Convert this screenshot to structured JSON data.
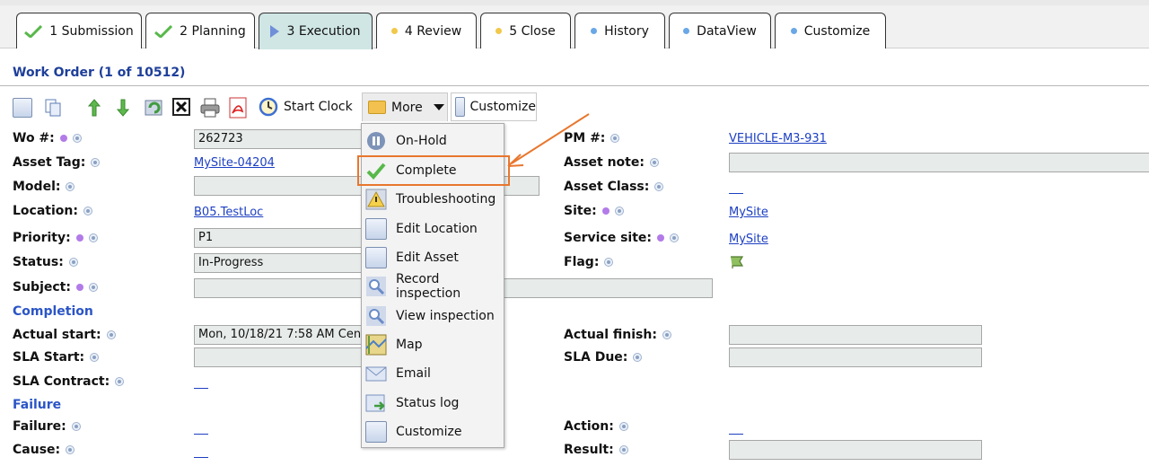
{
  "tabs": [
    {
      "label": "1 Submission",
      "marker": "check-icon"
    },
    {
      "label": "2 Planning",
      "marker": "check-icon"
    },
    {
      "label": "3 Execution",
      "marker": "play-icon",
      "active": true
    },
    {
      "label": "4 Review",
      "marker": "yellow-dot-icon"
    },
    {
      "label": "5 Close",
      "marker": "yellow-dot-icon"
    },
    {
      "label": "History",
      "marker": "blue-dot-icon"
    },
    {
      "label": "DataView",
      "marker": "blue-dot-icon"
    },
    {
      "label": "Customize",
      "marker": "blue-dot-icon"
    }
  ],
  "header": {
    "title": "Work Order (1 of 10512)"
  },
  "toolbar": {
    "start_clock": "Start Clock",
    "more": "More",
    "customize": "Customize"
  },
  "menu": {
    "items": [
      {
        "label": "On-Hold",
        "icon": "pause-icon"
      },
      {
        "label": "Complete",
        "icon": "check-icon"
      },
      {
        "label": "Troubleshooting",
        "icon": "warning-icon"
      },
      {
        "label": "Edit Location",
        "icon": "edit-icon"
      },
      {
        "label": "Edit Asset",
        "icon": "edit-icon"
      },
      {
        "label": "Record inspection",
        "icon": "magnifier-icon"
      },
      {
        "label": "View inspection",
        "icon": "magnifier-icon"
      },
      {
        "label": "Map",
        "icon": "map-icon"
      },
      {
        "label": "Email",
        "icon": "email-icon"
      },
      {
        "label": "Status log",
        "icon": "status-log-icon"
      },
      {
        "label": "Customize",
        "icon": "edit-icon"
      }
    ]
  },
  "form": {
    "wo_label": "Wo #:",
    "wo_value": "262723",
    "asset_tag_label": "Asset Tag:",
    "asset_tag_value": "MySite-04204",
    "model_label": "Model:",
    "location_label": "Location:",
    "location_value": "B05.TestLoc",
    "priority_label": "Priority:",
    "priority_value": "P1",
    "status_label": "Status:",
    "status_value": "In-Progress",
    "subject_label": "Subject:",
    "completion_section": "Completion",
    "actual_start_label": "Actual start:",
    "actual_start_value": "Mon, 10/18/21 7:58 AM Cen",
    "sla_start_label": "SLA Start:",
    "sla_contract_label": "SLA Contract:",
    "failure_section": "Failure",
    "failure_label": "Failure:",
    "cause_label": "Cause:",
    "pm_label": "PM #:",
    "pm_value": "VEHICLE-M3-931",
    "asset_note_label": "Asset note:",
    "asset_class_label": "Asset Class:",
    "site_label": "Site:",
    "site_value": "MySite",
    "service_site_label": "Service site:",
    "service_site_value": "MySite",
    "flag_label": "Flag:",
    "actual_finish_label": "Actual finish:",
    "sla_due_label": "SLA Due:",
    "action_label": "Action:",
    "result_label": "Result:"
  },
  "colors": {
    "accent_link": "#1c3fc2",
    "section": "#2b55c6",
    "highlight": "#e8772e",
    "active_tab": "#cfe6e4"
  }
}
